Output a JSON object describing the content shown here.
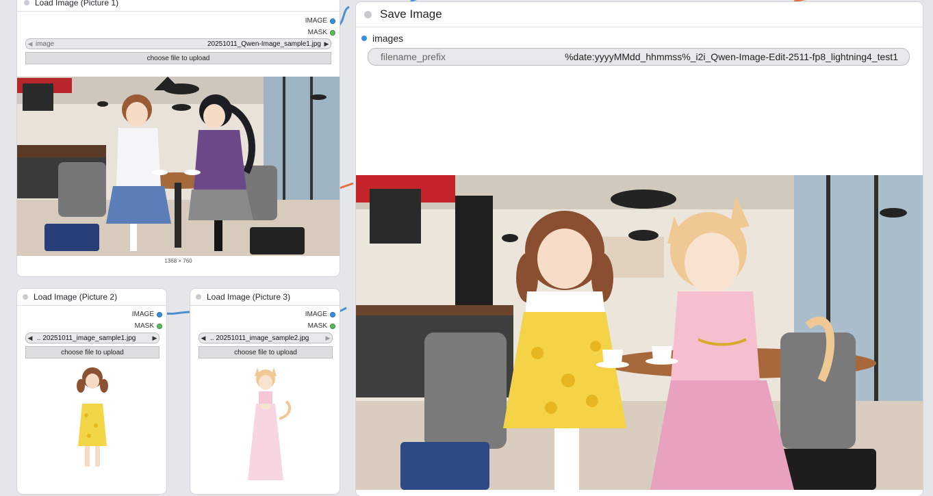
{
  "nodes": {
    "picture1": {
      "title": "Load Image (Picture 1)",
      "outputs": [
        "IMAGE",
        "MASK"
      ],
      "combo_label": "image",
      "combo_value": "20251011_Qwen-Image_sample1.jpg",
      "upload_label": "choose file to upload",
      "dimensions": "1368 × 760"
    },
    "picture2": {
      "title": "Load Image (Picture 2)",
      "outputs": [
        "IMAGE",
        "MASK"
      ],
      "combo_value": ".. 20251011_image_sample1.jpg",
      "upload_label": "choose file to upload"
    },
    "picture3": {
      "title": "Load Image (Picture 3)",
      "outputs": [
        "IMAGE",
        "MASK"
      ],
      "combo_value": ".. 20251011_image_sample2.jpg",
      "upload_label": "choose file to upload"
    },
    "save": {
      "title": "Save Image",
      "input_label": "images",
      "prefix_label": "filename_prefix",
      "prefix_value": "%date:yyyyMMdd_hhmmss%_i2i_Qwen-Image-Edit-2511-fp8_lightning4_test1"
    }
  },
  "icons": {
    "combo_left": "◀",
    "combo_right": "▶"
  },
  "colors": {
    "image_socket": "#3b8fd9",
    "mask_socket": "#5cb85c",
    "wire": "#4a8fd0"
  }
}
